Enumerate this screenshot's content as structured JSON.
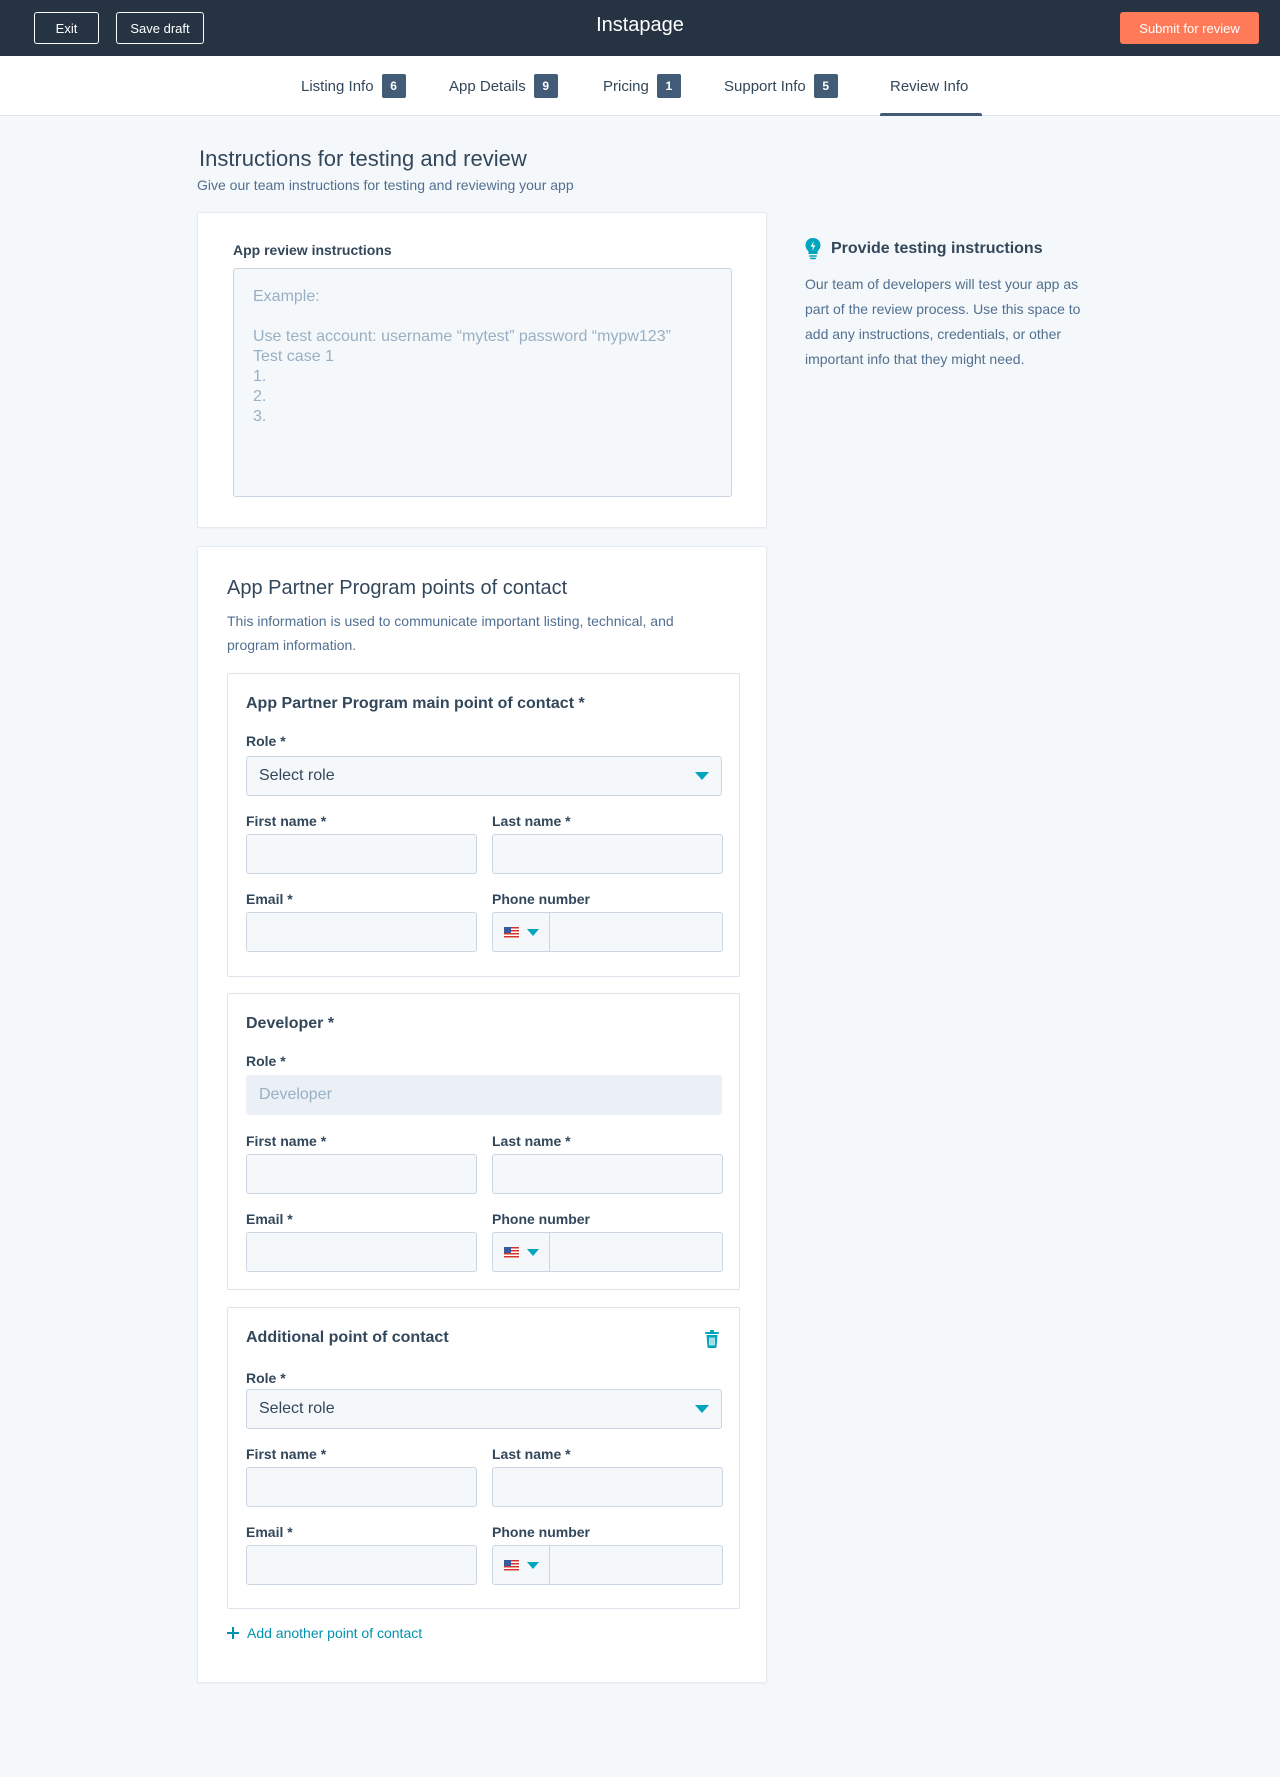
{
  "header": {
    "exit_label": "Exit",
    "save_draft_label": "Save draft",
    "title": "Instapage",
    "submit_label": "Submit for review"
  },
  "tabs": [
    {
      "label": "Listing Info",
      "badge": "6"
    },
    {
      "label": "App Details",
      "badge": "9"
    },
    {
      "label": "Pricing",
      "badge": "1"
    },
    {
      "label": "Support Info",
      "badge": "5"
    },
    {
      "label": "Review Info",
      "badge": ""
    }
  ],
  "page": {
    "title": "Instructions for testing and review",
    "subtitle": "Give our team instructions for testing and reviewing your app"
  },
  "review": {
    "label": "App review instructions",
    "placeholder": "Example:\n\nUse test account: username “mytest” password “mypw123”\nTest case 1\n1.\n2.\n3."
  },
  "tip": {
    "icon": "lightbulb-icon",
    "title": "Provide testing instructions",
    "body": "Our team of developers will test your app as part of the review process. Use this space to add any instructions, credentials, or other important info that they might need."
  },
  "contacts_section": {
    "title": "App Partner Program points of contact",
    "description": "This information is used to communicate important listing, technical, and program information.",
    "add_link": "Add another point of contact"
  },
  "fields": {
    "role": "Role *",
    "first_name": "First name *",
    "last_name": "Last name *",
    "email": "Email *",
    "phone": "Phone number"
  },
  "contacts": [
    {
      "title": "App Partner Program main point of contact *",
      "role_value": "Select role"
    },
    {
      "title": "Developer *",
      "role_value": "Developer"
    },
    {
      "title": "Additional point of contact",
      "role_value": "Select role"
    }
  ],
  "colors": {
    "header_bg": "#253342",
    "accent": "#ff7a59",
    "link": "#0091ae",
    "caret": "#00a4bd"
  }
}
